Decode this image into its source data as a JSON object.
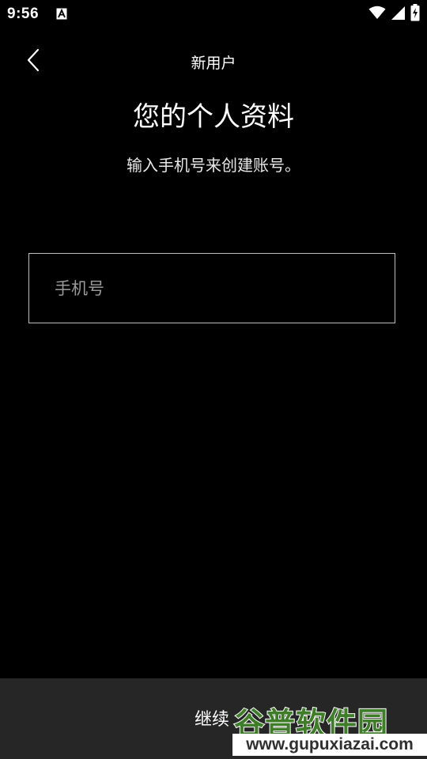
{
  "status_bar": {
    "time": "9:56",
    "icons": [
      "accessibility-a-icon",
      "wifi-icon",
      "cell-signal-icon",
      "battery-charging-icon"
    ]
  },
  "toolbar": {
    "title": "新用户",
    "back_icon": "chevron-left-icon"
  },
  "profile": {
    "title": "您的个人资料",
    "subtitle": "输入手机号来创建账号。"
  },
  "phone_field": {
    "placeholder": "手机号",
    "value": ""
  },
  "footer": {
    "continue_label": "继续"
  },
  "watermark": {
    "brand": "谷普软件园",
    "url": "www.gupuxiazai.com"
  },
  "colors": {
    "background": "#000000",
    "bottom_bar": "#262626",
    "field_border": "#bdbdbd",
    "placeholder": "#9a9a9a",
    "watermark_green": "#3f7d2a"
  }
}
